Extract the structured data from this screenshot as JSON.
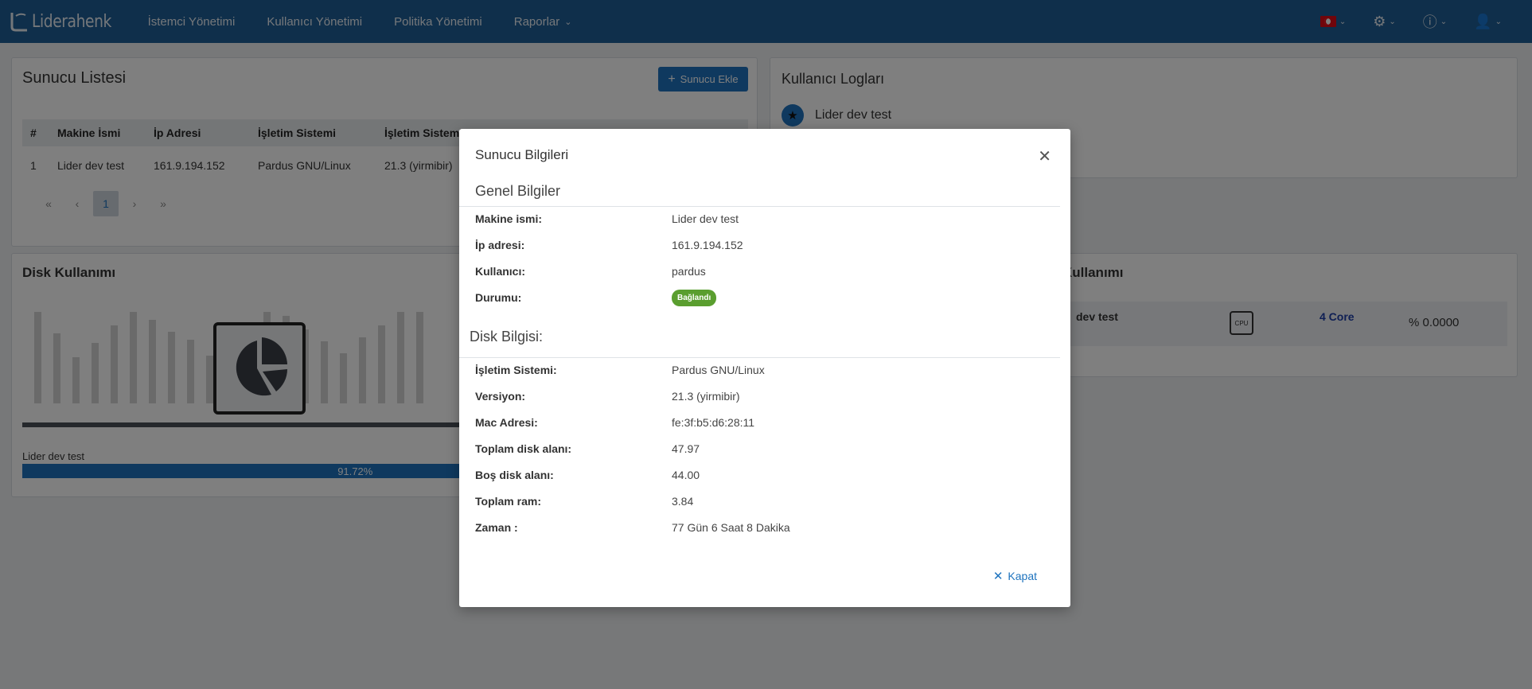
{
  "navbar": {
    "brand": "Liderahenk",
    "items": [
      {
        "label": "İstemci Yönetimi"
      },
      {
        "label": "Kullanıcı Yönetimi"
      },
      {
        "label": "Politika Yönetimi"
      },
      {
        "label": "Raporlar"
      }
    ]
  },
  "server_list": {
    "title": "Sunucu Listesi",
    "add_button": "Sunucu Ekle",
    "columns": [
      "#",
      "Makine İsmi",
      "İp Adresi",
      "İşletim Sistemi",
      "İşletim Sistemi V..."
    ],
    "rows": [
      [
        "1",
        "Lider dev test",
        "161.9.194.152",
        "Pardus GNU/Linux",
        "21.3 (yirmibir)"
      ]
    ],
    "pager": {
      "current": "1"
    }
  },
  "user_logs": {
    "title": "Kullanıcı Logları",
    "entry_name": "Lider dev test"
  },
  "disk_usage": {
    "title": "Disk Kullanımı",
    "server_name": "Lider dev test",
    "percent_label": "91.72%",
    "percent_value": 91.72
  },
  "cpu_usage": {
    "title": "Kullanımı",
    "server_name": "dev test",
    "cores": "4 Core",
    "usage": "% 0.0000"
  },
  "modal": {
    "title": "Sunucu Bilgileri",
    "general_section": "Genel Bilgiler",
    "general_rows": [
      {
        "label": "Makine ismi:",
        "value": "Lider dev test"
      },
      {
        "label": "İp adresi:",
        "value": "161.9.194.152"
      },
      {
        "label": "Kullanıcı:",
        "value": "pardus"
      },
      {
        "label": "Durumu:",
        "value": "Bağlandı"
      }
    ],
    "disk_section": "Disk Bilgisi:",
    "disk_rows": [
      {
        "label": "İşletim Sistemi:",
        "value": "Pardus GNU/Linux"
      },
      {
        "label": "Versiyon:",
        "value": "21.3 (yirmibir)"
      },
      {
        "label": "Mac Adresi:",
        "value": "fe:3f:b5:d6:28:11"
      },
      {
        "label": "Toplam disk alanı:",
        "value": "47.97"
      },
      {
        "label": "Boş disk alanı:",
        "value": "44.00"
      },
      {
        "label": "Toplam ram:",
        "value": "3.84"
      },
      {
        "label": "Zaman :",
        "value": "77 Gün 6 Saat 8 Dakika"
      }
    ],
    "close_button": "Kapat"
  },
  "colors": {
    "navbar": "#1f5f96",
    "primary": "#1e73be",
    "status_connected": "#5a9e2f"
  }
}
